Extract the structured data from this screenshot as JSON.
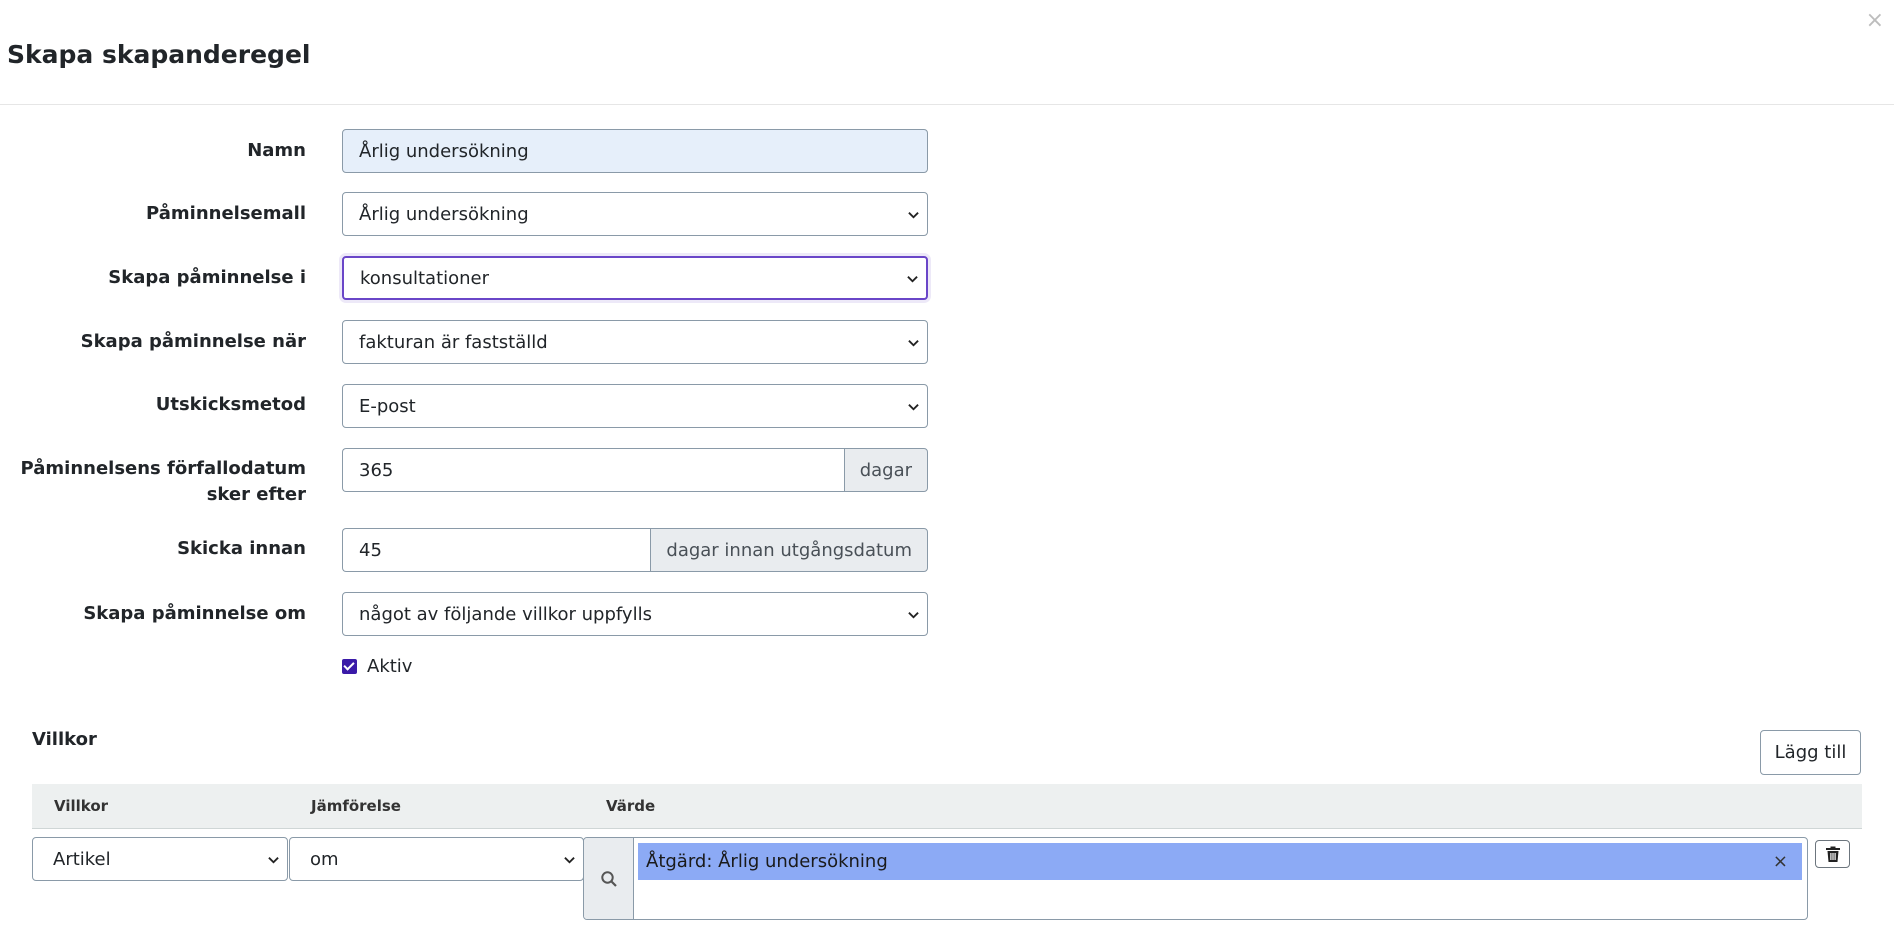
{
  "modal": {
    "title": "Skapa skapanderegel",
    "close_label": "×"
  },
  "form": {
    "name": {
      "label": "Namn",
      "value": "Årlig undersökning"
    },
    "template": {
      "label": "Påminnelsemall",
      "value": "Årlig undersökning"
    },
    "create_in": {
      "label": "Skapa påminnelse i",
      "value": "konsultationer"
    },
    "create_when": {
      "label": "Skapa påminnelse när",
      "value": "fakturan är fastställd"
    },
    "method": {
      "label": "Utskicksmetod",
      "value": "E-post"
    },
    "due_after": {
      "label_line1": "Påminnelsens förfallodatum",
      "label_line2": "sker efter",
      "value": "365",
      "addon": "dagar"
    },
    "send_before": {
      "label": "Skicka innan",
      "value": "45",
      "addon": "dagar innan utgångsdatum"
    },
    "create_if": {
      "label": "Skapa påminnelse om",
      "value": "något av följande villkor uppfylls"
    },
    "active": {
      "label": "Aktiv",
      "checked": true
    }
  },
  "conditions": {
    "title": "Villkor",
    "add_label": "Lägg till",
    "headers": {
      "condition": "Villkor",
      "comparison": "Jämförelse",
      "value": "Värde"
    },
    "rows": [
      {
        "condition": "Artikel",
        "comparison": "om",
        "value_tag": "Åtgärd: Årlig undersökning",
        "tag_remove": "×"
      }
    ]
  },
  "colors": {
    "accent": "#3a1aa8",
    "tag_bg": "#8caaf5",
    "header_bg": "#edf0f0"
  }
}
